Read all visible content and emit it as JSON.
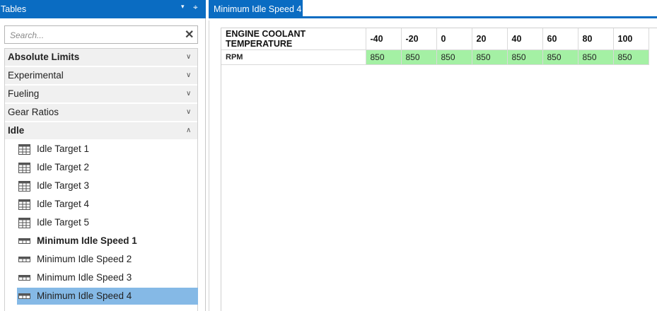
{
  "left_panel": {
    "title": "Tables",
    "dropdown_glyph": "▾",
    "pin_glyph": "⌖",
    "search": {
      "placeholder": "Search...",
      "value": "",
      "clear_glyph": "✕"
    },
    "groups": [
      {
        "label": "Absolute Limits",
        "expanded": false,
        "chevron": "∨"
      },
      {
        "label": "Experimental",
        "expanded": false,
        "chevron": "∨"
      },
      {
        "label": "Fueling",
        "expanded": false,
        "chevron": "∨"
      },
      {
        "label": "Gear Ratios",
        "expanded": false,
        "chevron": "∨"
      },
      {
        "label": "Idle",
        "expanded": true,
        "chevron": "∧"
      }
    ],
    "idle_items": [
      {
        "label": "Idle Target 1",
        "icon": "grid-table-icon"
      },
      {
        "label": "Idle Target 2",
        "icon": "grid-table-icon"
      },
      {
        "label": "Idle Target 3",
        "icon": "grid-table-icon"
      },
      {
        "label": "Idle Target 4",
        "icon": "grid-table-icon"
      },
      {
        "label": "Idle Target 5",
        "icon": "grid-table-icon"
      },
      {
        "label": "Minimum Idle Speed 1",
        "icon": "row-table-icon",
        "bold": true
      },
      {
        "label": "Minimum Idle Speed 2",
        "icon": "row-table-icon"
      },
      {
        "label": "Minimum Idle Speed 3",
        "icon": "row-table-icon"
      },
      {
        "label": "Minimum Idle Speed 4",
        "icon": "row-table-icon",
        "selected": true
      }
    ]
  },
  "document": {
    "tab_label": "Minimum Idle Speed 4",
    "table": {
      "header_label": "ENGINE COOLANT TEMPERATURE",
      "columns": [
        "-40",
        "-20",
        "0",
        "20",
        "40",
        "60",
        "80",
        "100"
      ],
      "row_label": "RPM",
      "values": [
        "850",
        "850",
        "850",
        "850",
        "850",
        "850",
        "850",
        "850"
      ]
    }
  },
  "colors": {
    "accent": "#0a6cc2",
    "selected_row": "#85b9e6",
    "cell_highlight": "#a4f0a4",
    "group_background": "#f0f0f0"
  }
}
